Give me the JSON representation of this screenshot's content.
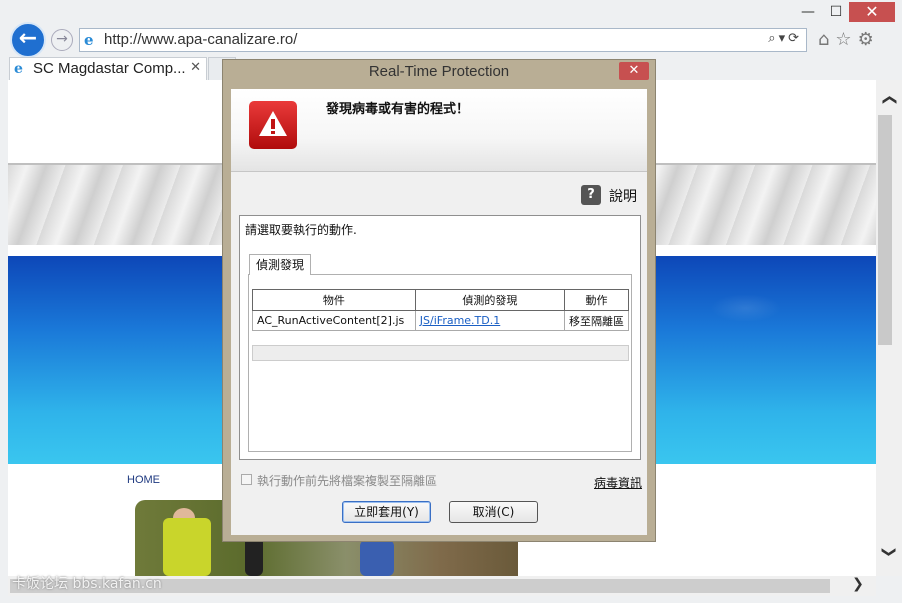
{
  "browser": {
    "window_controls": {
      "minimize": "—",
      "maximize": "☐",
      "close": "✕"
    },
    "back": "←",
    "forward": "→",
    "url": "http://www.apa-canalizare.ro/",
    "address_tools": "⌕▾⟳",
    "nav_icons": "⌂☆⚙",
    "tab_title": "SC Magdastar Comp...",
    "tab_close": "✕"
  },
  "page": {
    "nav_home": "HOME",
    "watermark": "卡饭论坛 bbs.kafan.cn"
  },
  "scrollbars": {
    "up": "❯",
    "down": "❯",
    "right": "❯"
  },
  "dialog": {
    "title": "Real-Time Protection",
    "close": "✕",
    "headline": "發現病毒或有害的程式！",
    "help_label": "說明",
    "help_icon": "?",
    "action_prompt": "請選取要執行的動作.",
    "tab_label": "偵測發現",
    "table": {
      "headers": [
        "物件",
        "偵測的發現",
        "動作"
      ],
      "rows": [
        {
          "object": "AC_RunActiveContent[2].js",
          "finding": "JS/iFrame.TD.1",
          "action": "移至隔離區"
        }
      ]
    },
    "copy_checkbox_label": "執行動作前先將檔案複製至隔離區",
    "virus_info_link": "病毒資訊",
    "apply_button": "立即套用(Y)",
    "cancel_button": "取消(C)"
  },
  "colors": {
    "accent_blue": "#1f6fd0",
    "close_red": "#c75050",
    "warning_red": "#d41f1f",
    "dialog_frame": "#b9ae95",
    "link_blue": "#1a5fc4"
  }
}
